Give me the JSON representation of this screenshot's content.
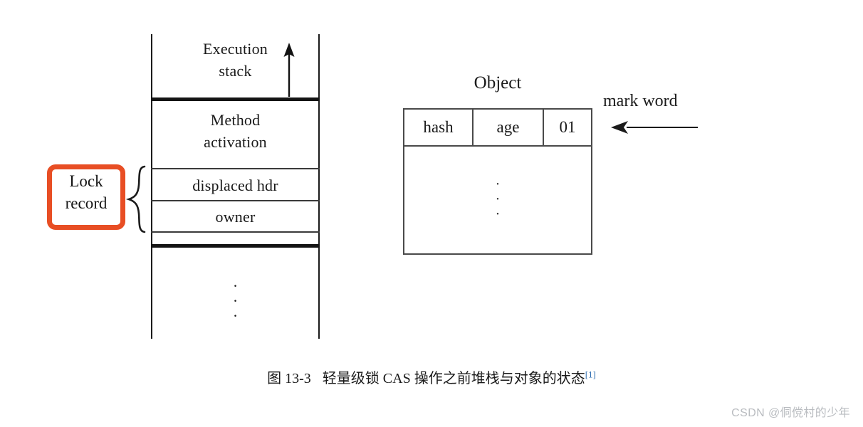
{
  "figure": {
    "caption_number": "图 13-3",
    "caption_text": "轻量级锁 CAS 操作之前堆栈与对象的状态",
    "caption_ref": "[1]",
    "ref_color": "#2B6CB0"
  },
  "stack": {
    "frames": [
      {
        "id": "execution-stack",
        "label": "Execution\nstack"
      },
      {
        "id": "method-activation",
        "label": "Method\nactivation"
      },
      {
        "id": "displaced-hdr",
        "label": "displaced hdr"
      },
      {
        "id": "owner",
        "label": "owner"
      }
    ],
    "execution_stack_line1": "Execution",
    "execution_stack_line2": "stack",
    "method_activation_line1": "Method",
    "method_activation_line2": "activation",
    "displaced_hdr_label": "displaced hdr",
    "owner_label": "owner",
    "ellipsis": "·",
    "growth_arrow_direction": "up"
  },
  "annotation": {
    "lock_record_line1": "Lock",
    "lock_record_line2": "record",
    "highlight_color": "#E84E24",
    "brace": "{"
  },
  "object": {
    "title": "Object",
    "mark_word_columns": [
      "hash",
      "age",
      "01"
    ],
    "body_ellipsis": "·",
    "mark_word_label": "mark word",
    "mark_word_arrow_direction": "left"
  },
  "watermark": {
    "text": "CSDN @侗傥村的少年"
  }
}
